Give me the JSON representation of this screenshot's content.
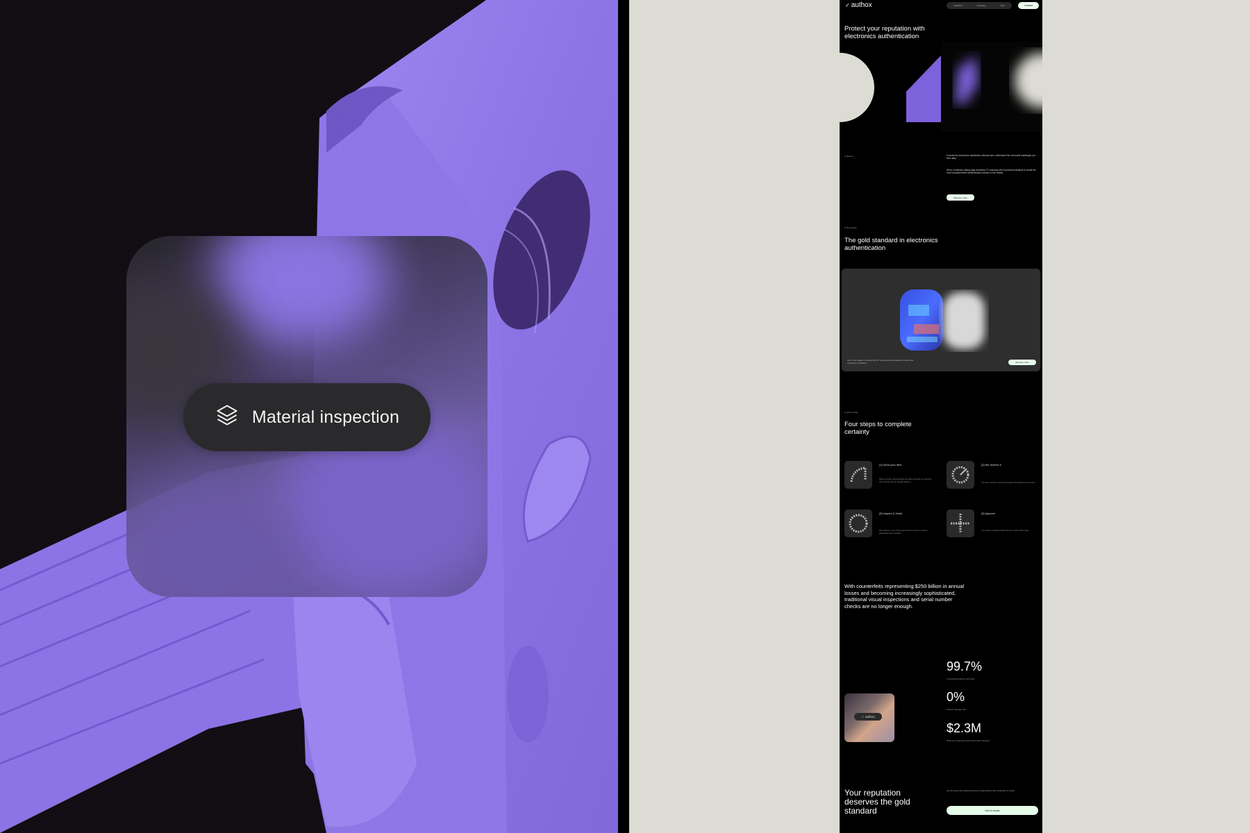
{
  "left": {
    "pill_label": "Material inspection",
    "pill_icon": "layers-icon",
    "accent": "#8a6fe8"
  },
  "site": {
    "logo": "authox",
    "logo_icon": "checkmark-icon",
    "nav_items": [
      "Solutions",
      "Company",
      "Tech"
    ],
    "contact_label": "Contact",
    "hero_title": "Protect your reputation with electronics authentication",
    "mission": {
      "tag": "● Mission",
      "p1": "Founded by electronics distribution veterans who understand the real-world challenges you face daily.",
      "p2": "We've combined cutting-edge industrial CT scanning with AI-powered analysis to create the most comprehensive authentication solution in the market.",
      "button": "Discover more"
    },
    "technology": {
      "tag": "● Technology",
      "title": "The gold standard in electronics authentication",
      "card_text": "First in the market to combine 3D CT scanning with AI analysis for board and component verification.",
      "button": "Discover more"
    },
    "how": {
      "tag": "● How it works",
      "title": "Four steps to complete certainty",
      "steps": [
        {
          "title": "[1]  Send your item",
          "desc": "Pack your item and schedule the pickup through our partners who provide secure, tracked delivery."
        },
        {
          "title": "[2]  We receive it",
          "desc": "Our team confirms receipt and begins the assessment process."
        },
        {
          "title": "[3]  Inspect & Verify",
          "desc": "We examine every component with CT and AI to confirm authenticity and condition."
        },
        {
          "title": "[4]  Approve",
          "desc": "You receive a detailed authentication report within days."
        }
      ]
    },
    "counterfeit_text": "With counterfeits representing $250 billion in annual losses and becoming increasingly sophisticated, traditional visual inspections and serial number checks are no longer enough.",
    "stats": [
      {
        "value": "99.7%",
        "label": "Counterfeit detection accuracy"
      },
      {
        "value": "0%",
        "label": "Product damage rate"
      },
      {
        "value": "$2.3M",
        "label": "What our customers saved with each detection"
      }
    ],
    "badge_label": "authox",
    "cta": {
      "title": "Your reputation deserves the gold standard",
      "text": "Join the electronics distributors who've made AuthOx their verification of choice",
      "button": "Get in touch"
    }
  }
}
